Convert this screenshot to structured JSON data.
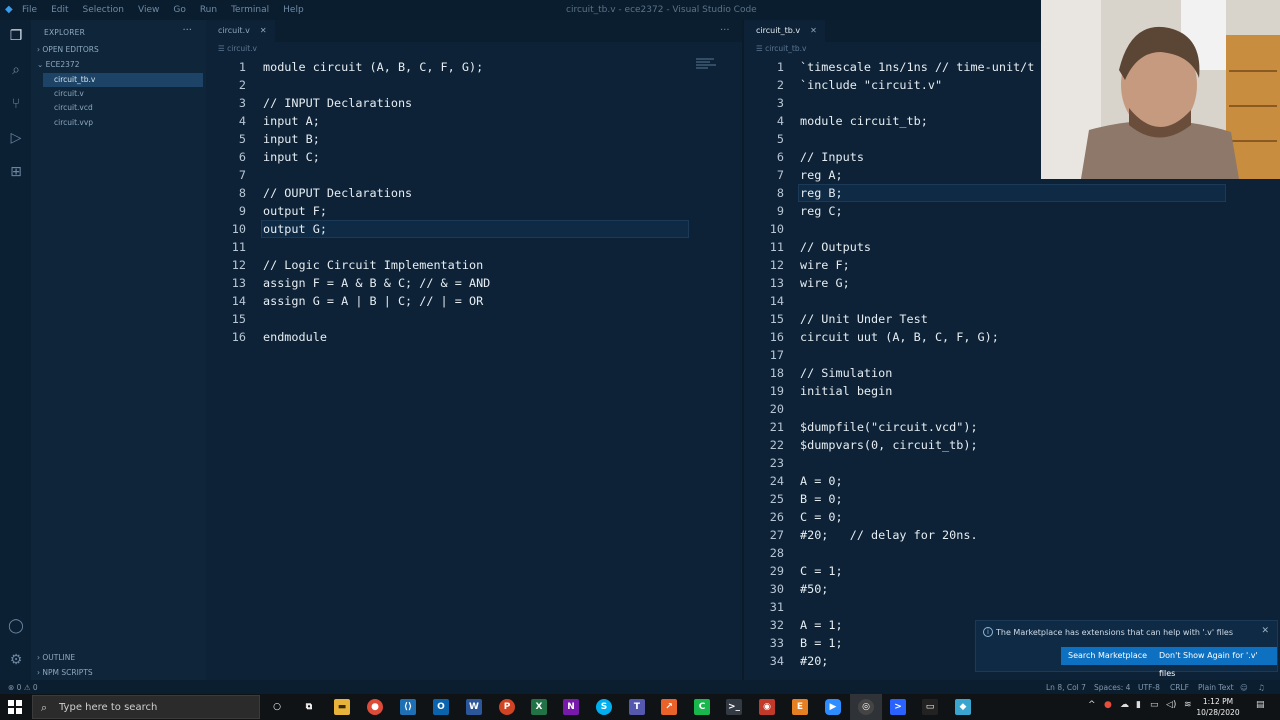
{
  "window": {
    "title": "circuit_tb.v - ece2372 - Visual Studio Code",
    "menu": [
      "File",
      "Edit",
      "Selection",
      "View",
      "Go",
      "Run",
      "Terminal",
      "Help"
    ]
  },
  "sidebar": {
    "header": "EXPLORER",
    "open_editors": "OPEN EDITORS",
    "folder": "ECE2372",
    "files": [
      "circuit_tb.v",
      "circuit.v",
      "circuit.vcd",
      "circuit.vvp"
    ],
    "outline": "OUTLINE",
    "npm_scripts": "NPM SCRIPTS"
  },
  "left_editor": {
    "tab": "circuit.v",
    "breadcrumb": "circuit.v",
    "lines": [
      "module circuit (A, B, C, F, G);",
      "",
      "// INPUT Declarations",
      "input A;",
      "input B;",
      "input C;",
      "",
      "// OUPUT Declarations",
      "output F;",
      "output G;",
      "",
      "// Logic Circuit Implementation",
      "assign F = A & B & C; // & = AND",
      "assign G = A | B | C; // | = OR",
      "",
      "endmodule"
    ],
    "current_line": 10
  },
  "right_editor": {
    "tab": "circuit_tb.v",
    "breadcrumb": "circuit_tb.v",
    "lines": [
      "`timescale 1ns/1ns // time-unit/t",
      "`include \"circuit.v\"",
      "",
      "module circuit_tb;",
      "",
      "// Inputs",
      "reg A;",
      "reg B;",
      "reg C;",
      "",
      "// Outputs",
      "wire F;",
      "wire G;",
      "",
      "// Unit Under Test",
      "circuit uut (A, B, C, F, G);",
      "",
      "// Simulation",
      "initial begin",
      "",
      "$dumpfile(\"circuit.vcd\");",
      "$dumpvars(0, circuit_tb);",
      "",
      "A = 0;",
      "B = 0;",
      "C = 0;",
      "#20;   // delay for 20ns.",
      "",
      "C = 1;",
      "#50;",
      "",
      "A = 1;",
      "B = 1;",
      "#20;"
    ],
    "current_line": 8
  },
  "notification": {
    "message": "The Marketplace has extensions that can help with '.v' files",
    "primary_button": "Search Marketplace",
    "secondary_button": "Don't Show Again for '.v' files"
  },
  "statusbar": {
    "problems": "⊗ 0  ⚠ 0",
    "cursor": "Ln 8, Col 7",
    "spaces": "Spaces: 4",
    "encoding": "UTF-8",
    "eol": "CRLF",
    "language": "Plain Text"
  },
  "taskbar": {
    "search_placeholder": "Type here to search",
    "time": "1:12 PM",
    "date": "10/28/2020"
  }
}
